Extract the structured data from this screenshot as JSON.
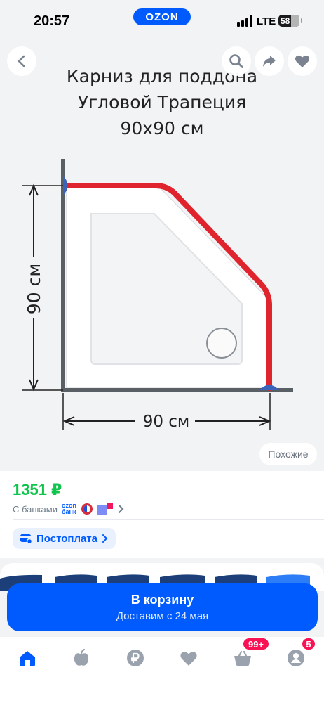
{
  "status_bar": {
    "time": "20:57",
    "network": "LTE",
    "battery": "58",
    "app_logo": "OZON"
  },
  "gallery": {
    "image_title_lines": [
      "Карниз для поддона",
      "Угловой Трапеция",
      "90x90 см"
    ],
    "dimension_vertical": "90 см",
    "dimension_horizontal": "90 см",
    "similar_label": "Похожие",
    "icons": [
      "back-icon",
      "search-icon",
      "share-icon",
      "heart-icon"
    ]
  },
  "price": {
    "value": "1351 ₽",
    "with_banks_label": "С банками",
    "ozon_bank_logo": [
      "ozon",
      "банк"
    ],
    "postpay_label": "Постоплата"
  },
  "cart": {
    "label": "В корзину",
    "delivery": "Доставим с 24 мая"
  },
  "tab_bar": {
    "tabs": [
      "home-icon",
      "fresh-icon",
      "ruble-icon",
      "favorites-icon",
      "cart-icon",
      "profile-icon"
    ],
    "cart_badge": "99+",
    "profile_badge": "5"
  },
  "colors": {
    "accent": "#005bff",
    "price": "#10c44c",
    "badge": "#f91155",
    "rod": "#e0242d"
  }
}
